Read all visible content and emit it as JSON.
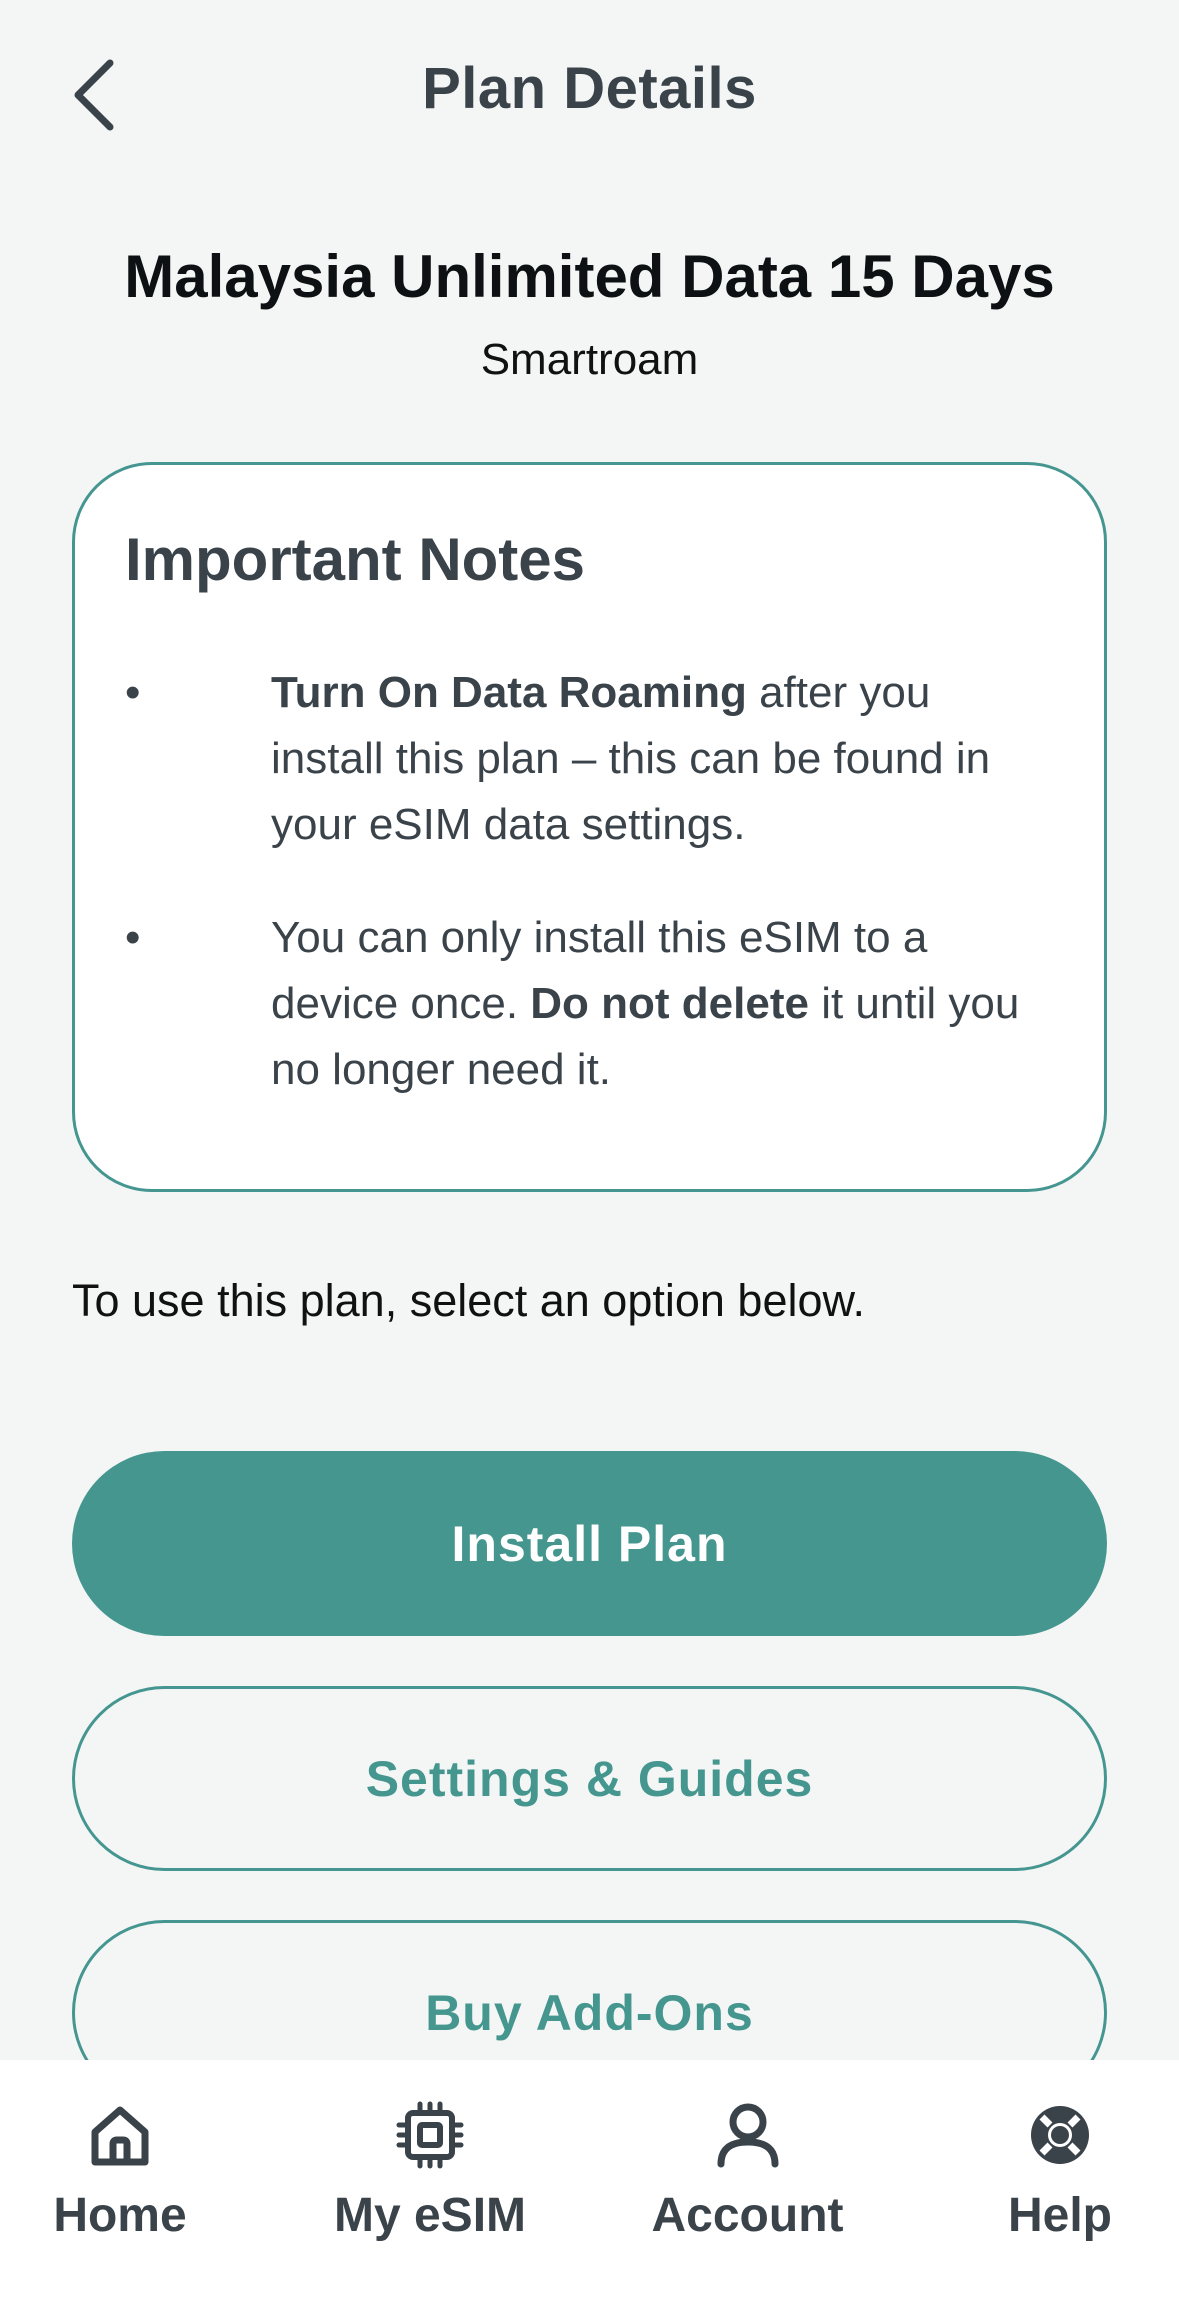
{
  "header": {
    "title": "Plan Details",
    "back_icon": "chevron-left-icon"
  },
  "plan": {
    "title": "Malaysia Unlimited Data 15 Days",
    "provider": "Smartroam"
  },
  "notes": {
    "title": "Important Notes",
    "items": [
      {
        "bold": "Turn On Data Roaming",
        "rest": " after you install this plan – this can be found in your eSIM data settings."
      },
      {
        "before": "You can only install this eSIM to a device once. ",
        "bold": "Do not delete",
        "after": " it until you no longer need it."
      }
    ]
  },
  "instruction": "To use this plan, select an option below.",
  "buttons": {
    "install": "Install Plan",
    "settings": "Settings & Guides",
    "addons": "Buy Add-Ons"
  },
  "nav": {
    "home": "Home",
    "esim": "My eSIM",
    "account": "Account",
    "help": "Help"
  },
  "colors": {
    "accent": "#45968f",
    "background": "#f4f6f5",
    "text": "#3b434a"
  }
}
